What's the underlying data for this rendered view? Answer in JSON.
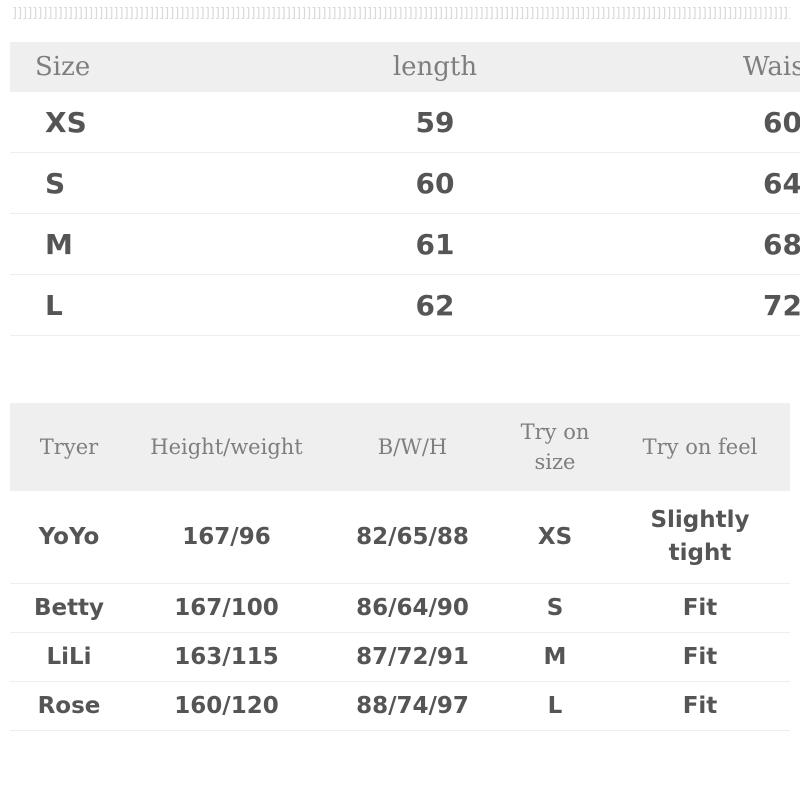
{
  "decoration": {
    "top_border_glyphs": "]]]]]]]]]]]]]]]]]]]]]]]]]]]]]]]]]]]]]]]]]]]]]]]]]]]]]]]]]]]]]]]]]]]]]]]]]]]]]]]]]]]]]]]]]]]]]]]]]]]]]]]]]]]]]]]]]]]]]]]]]]]]]]]]]]]]]]]]]]]]]]]]]]]]]]]]]]]]]]]]]]]]]]]]]]]]]]]]]]]]]]]]]]]]]]]]]]]]]]]]]]]]]]]]]]]]]]]]]]]]]]]]]]]]]]]]]]]]]]]]]]]]]]]]]]]]]]]]]]]]]]]]]]]]]]]]]]]]]]]]]]]]]]]]]]]]]]]]]]]]]]]]]]]]]]"
  },
  "colors": {
    "header_background": "#efefef",
    "header_text": "#7e7e7e",
    "body_text": "#555555",
    "row_divider": "#eeeeee",
    "page_background": "#ffffff",
    "decoration": "#d9d9d9"
  },
  "size_table": {
    "columns": [
      "Size",
      "length",
      "Waist"
    ],
    "rows": [
      {
        "size": "XS",
        "length": "59",
        "waist": "60"
      },
      {
        "size": "S",
        "length": "60",
        "waist": "64"
      },
      {
        "size": "M",
        "length": "61",
        "waist": "68"
      },
      {
        "size": "L",
        "length": "62",
        "waist": "72"
      }
    ]
  },
  "tryer_table": {
    "columns": [
      "Tryer",
      "Height/weight",
      "B/W/H",
      "Try on size",
      "Try on feel"
    ],
    "column_size_line1": "Try on",
    "column_size_line2": "size",
    "rows": [
      {
        "tryer": "YoYo",
        "height_weight": "167/96",
        "bwh": "82/65/88",
        "try_on_size": "XS",
        "try_on_feel_line1": "Slightly",
        "try_on_feel_line2": "tight"
      },
      {
        "tryer": "Betty",
        "height_weight": "167/100",
        "bwh": "86/64/90",
        "try_on_size": "S",
        "try_on_feel": "Fit"
      },
      {
        "tryer": "LiLi",
        "height_weight": "163/115",
        "bwh": "87/72/91",
        "try_on_size": "M",
        "try_on_feel": "Fit"
      },
      {
        "tryer": "Rose",
        "height_weight": "160/120",
        "bwh": "88/74/97",
        "try_on_size": "L",
        "try_on_feel": "Fit"
      }
    ]
  }
}
